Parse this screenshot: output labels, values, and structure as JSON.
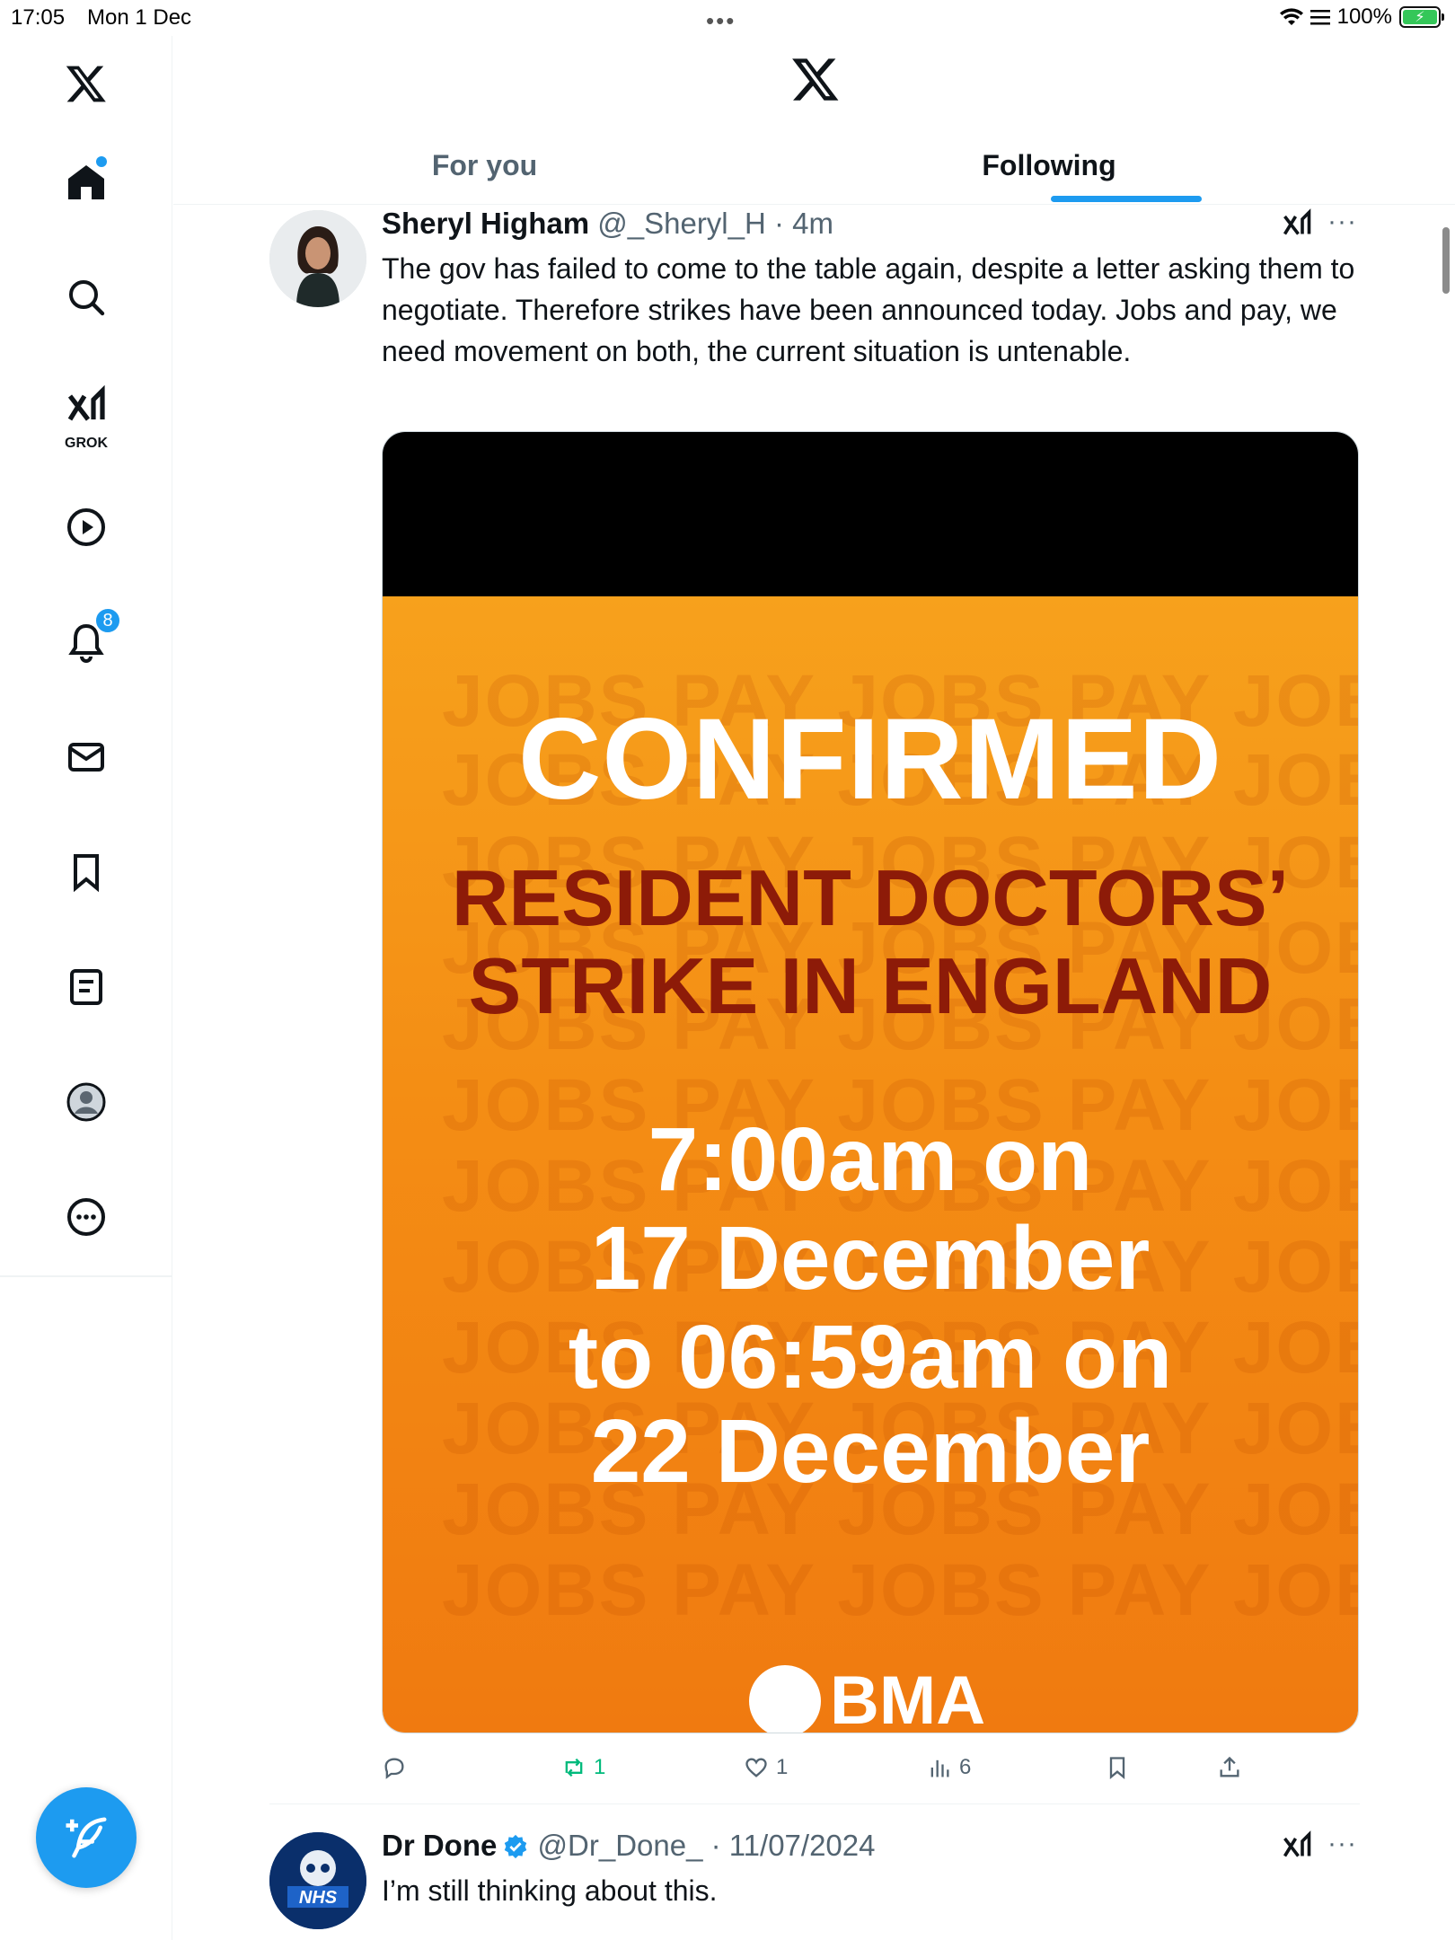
{
  "status_bar": {
    "time": "17:05",
    "date": "Mon 1 Dec",
    "battery": "100%"
  },
  "sidebar": {
    "grok_label": "GROK",
    "notifications_count": "8",
    "items": [
      "Home",
      "Explore",
      "Grok",
      "Video",
      "Notifications",
      "Messages",
      "Bookmarks",
      "Lists",
      "Profile",
      "More"
    ]
  },
  "tabs": {
    "for_you": "For you",
    "following": "Following",
    "active": "Following"
  },
  "tweets": [
    {
      "name": "Sheryl Higham",
      "handle": "@_Sheryl_H",
      "time": "4m",
      "text": "The gov has failed to come to the table again, despite a letter asking them to negotiate. Therefore strikes have been announced today. Jobs and pay, we need movement on both, the current situation is untenable.",
      "poster": {
        "watermark": "JOBS PAY JOBS PAY JOBS",
        "headline": "CONFIRMED",
        "line1": "RESIDENT DOCTORS’",
        "line2": "STRIKE IN ENGLAND",
        "time1": "7:00am on",
        "date1": "17 December",
        "time2": "to 06:59am on",
        "date2": "22 December",
        "logo": "BMA"
      },
      "stats": {
        "replies": "",
        "reposts": "1",
        "likes": "1",
        "views": "6"
      }
    },
    {
      "name": "Dr Done",
      "handle": "@Dr_Done_",
      "time": "11/07/2024",
      "text": "I’m still thinking about this.",
      "avatar_text": "NHS"
    }
  ],
  "colors": {
    "accent": "#1d9bf0",
    "repost": "#00ba7c",
    "poster_orange": "#f48d14",
    "poster_red": "#8d1b08"
  }
}
